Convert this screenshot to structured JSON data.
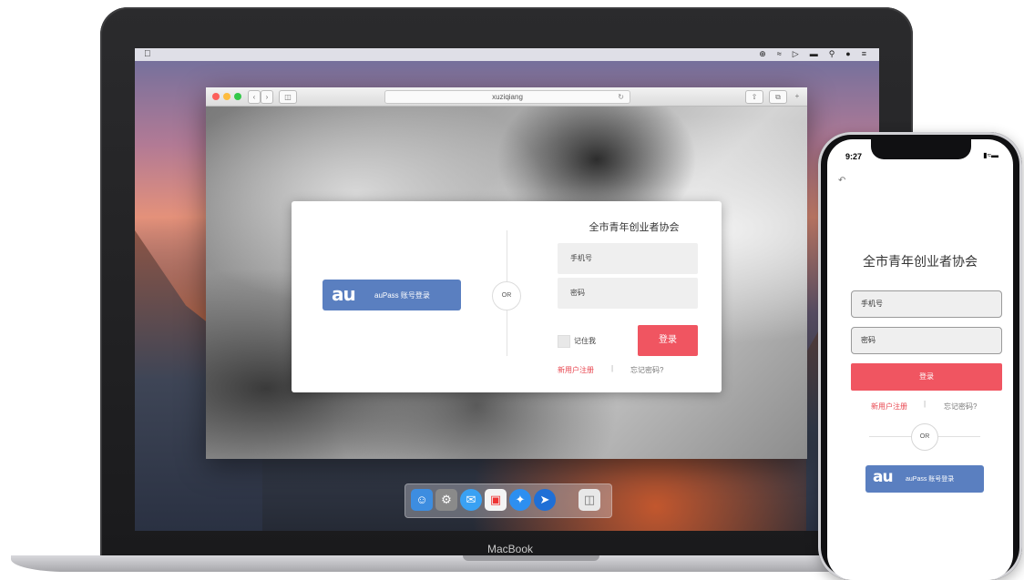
{
  "menubar": {
    "apple_icon": "apple-icon",
    "status_icons": [
      "bluetooth-icon",
      "wifi-icon",
      "volume-icon",
      "battery-icon",
      "search-icon",
      "siri-icon",
      "list-icon"
    ]
  },
  "browser": {
    "url": "xuziqiang"
  },
  "desktop_login": {
    "title": "全市青年创业者协会",
    "phone_placeholder": "手机号",
    "password_placeholder": "密码",
    "remember_label": "记住我",
    "login_label": "登录",
    "register_link": "新用户注册",
    "separator": "|",
    "forgot_link": "忘记密码?",
    "or_label": "OR",
    "au_logo": "au",
    "au_label": "auPass 账号登录"
  },
  "laptop_label": "MacBook",
  "phone": {
    "time": "9:27",
    "title": "全市青年创业者协会",
    "phone_placeholder": "手机号",
    "password_placeholder": "密码",
    "login_label": "登录",
    "register_link": "新用户注册",
    "separator": "|",
    "forgot_link": "忘记密码?",
    "or_label": "OR",
    "au_logo": "au",
    "au_label": "auPass 账号登录"
  },
  "colors": {
    "accent_red": "#f05561",
    "au_blue": "#5a7fc0",
    "register_red": "#e8464f"
  }
}
